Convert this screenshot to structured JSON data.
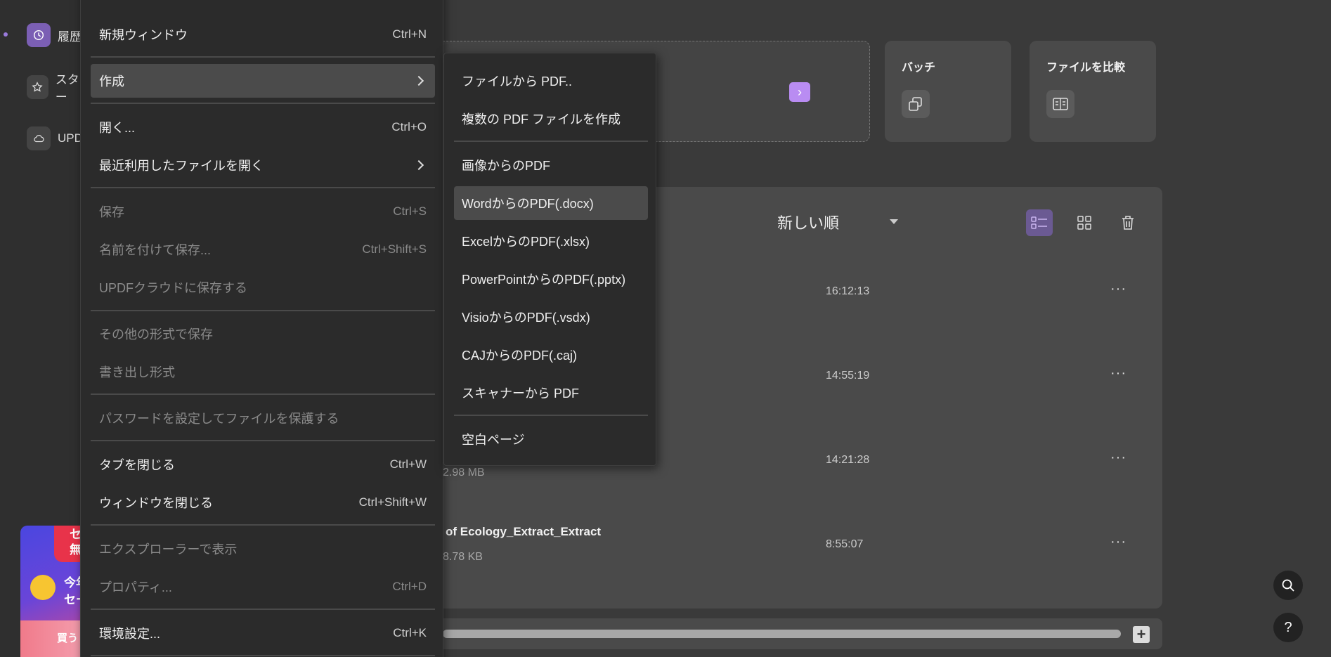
{
  "sidebar": {
    "items": [
      {
        "label": "履歴",
        "icon": "clock-icon"
      },
      {
        "label": "スター",
        "icon": "star-icon"
      },
      {
        "label": "UPD",
        "icon": "cloud-icon"
      }
    ]
  },
  "promo": {
    "badge_line1": "セ",
    "badge_line2": "無",
    "text_line1": "今年",
    "text_line2": "セー",
    "buy_label": "買う"
  },
  "tools": {
    "batch": "バッチ",
    "compare": "ファイルを比較"
  },
  "list": {
    "sort_label": "新しい順",
    "rows": [
      {
        "name": "",
        "size": "",
        "time": "16:12:13"
      },
      {
        "name": "",
        "size": "",
        "time": "14:55:19"
      },
      {
        "name": "",
        "size": "2.98 MB",
        "time": "14:21:28"
      },
      {
        "name": "of Ecology_Extract_Extract",
        "size": "8.78 KB",
        "time": "8:55:07"
      }
    ],
    "more": "···"
  },
  "file_menu": {
    "items": [
      {
        "label": "新規ウィンドウ",
        "shortcut": "Ctrl+N"
      },
      {
        "label": "作成",
        "shortcut": ""
      },
      {
        "label": "開く...",
        "shortcut": "Ctrl+O"
      },
      {
        "label": "最近利用したファイルを開く",
        "shortcut": ""
      },
      {
        "label": "保存",
        "shortcut": "Ctrl+S"
      },
      {
        "label": "名前を付けて保存...",
        "shortcut": "Ctrl+Shift+S"
      },
      {
        "label": "UPDFクラウドに保存する",
        "shortcut": ""
      },
      {
        "label": "その他の形式で保存",
        "shortcut": ""
      },
      {
        "label": "書き出し形式",
        "shortcut": ""
      },
      {
        "label": "パスワードを設定してファイルを保護する",
        "shortcut": ""
      },
      {
        "label": "タブを閉じる",
        "shortcut": "Ctrl+W"
      },
      {
        "label": "ウィンドウを閉じる",
        "shortcut": "Ctrl+Shift+W"
      },
      {
        "label": "エクスプローラーで表示",
        "shortcut": ""
      },
      {
        "label": "プロパティ...",
        "shortcut": "Ctrl+D"
      },
      {
        "label": "環境設定...",
        "shortcut": "Ctrl+K"
      }
    ]
  },
  "create_submenu": {
    "items": [
      {
        "label": "ファイルから PDF.."
      },
      {
        "label": "複数の PDF ファイルを作成"
      },
      {
        "label": "画像からのPDF"
      },
      {
        "label": "WordからのPDF(.docx)"
      },
      {
        "label": "ExcelからのPDF(.xlsx)"
      },
      {
        "label": "PowerPointからのPDF(.pptx)"
      },
      {
        "label": "VisioからのPDF(.vsdx)"
      },
      {
        "label": "CAJからのPDF(.caj)"
      },
      {
        "label": "スキャナーから PDF"
      },
      {
        "label": "空白ページ"
      }
    ]
  },
  "help": {
    "label": "?"
  },
  "colors": {
    "accent": "#7b5fb4",
    "arrow": "#b98cf2",
    "menu_bg": "#2b2b2b",
    "hover": "#4b4b4b"
  }
}
